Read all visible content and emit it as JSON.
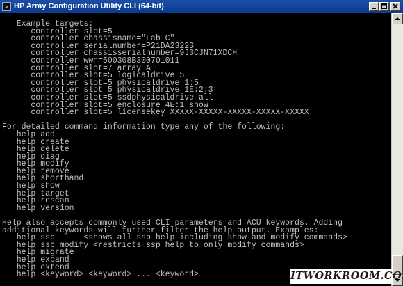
{
  "window": {
    "title": "HP Array Configuration Utility CLI (64-bit)",
    "icon": "console-app-icon",
    "controls": [
      "minimize-icon",
      "maximize-icon",
      "close-icon"
    ]
  },
  "console": {
    "lines": [
      "   Example targets:",
      "      controller slot=5",
      "      controller chassisname=\"Lab C\"",
      "      controller serialnumber=P21DA2322S",
      "      controller chassisserialnumber=9J3CJN71XDCH",
      "      controller wwn=500308B300701011",
      "      controller slot=7 array A",
      "      controller slot=5 logicaldrive 5",
      "      controller slot=5 physicaldrive 1:5",
      "      controller slot=5 physicaldrive 1E:2:3",
      "      controller slot=5 ssdphysicaldrive all",
      "      controller slot=5 enclosure 4E:1 show",
      "      controller slot=5 licensekey XXXXX-XXXXX-XXXXX-XXXXX-XXXXX",
      "",
      "For detailed command information type any of the following:",
      "   help add",
      "   help create",
      "   help delete",
      "   help diag",
      "   help modify",
      "   help remove",
      "   help shorthand",
      "   help show",
      "   help target",
      "   help rescan",
      "   help version",
      "",
      "Help also accepts commonly used CLI parameters and ACU keywords. Adding",
      "additional keywords will further filter the help output. Examples:",
      "   help ssp      <shows all ssp help including show and modify commands>",
      "   help ssp modify <restricts ssp help to only modify commands>",
      "   help migrate",
      "   help expand",
      "   help extend",
      "   help <keyword> <keyword> ... <keyword>"
    ]
  },
  "watermark": {
    "text": "ITWORKROOM.COM"
  },
  "colors": {
    "titlebar": "#0a3a8e",
    "console_bg": "#000000",
    "console_fg": "#c0c0c0"
  }
}
